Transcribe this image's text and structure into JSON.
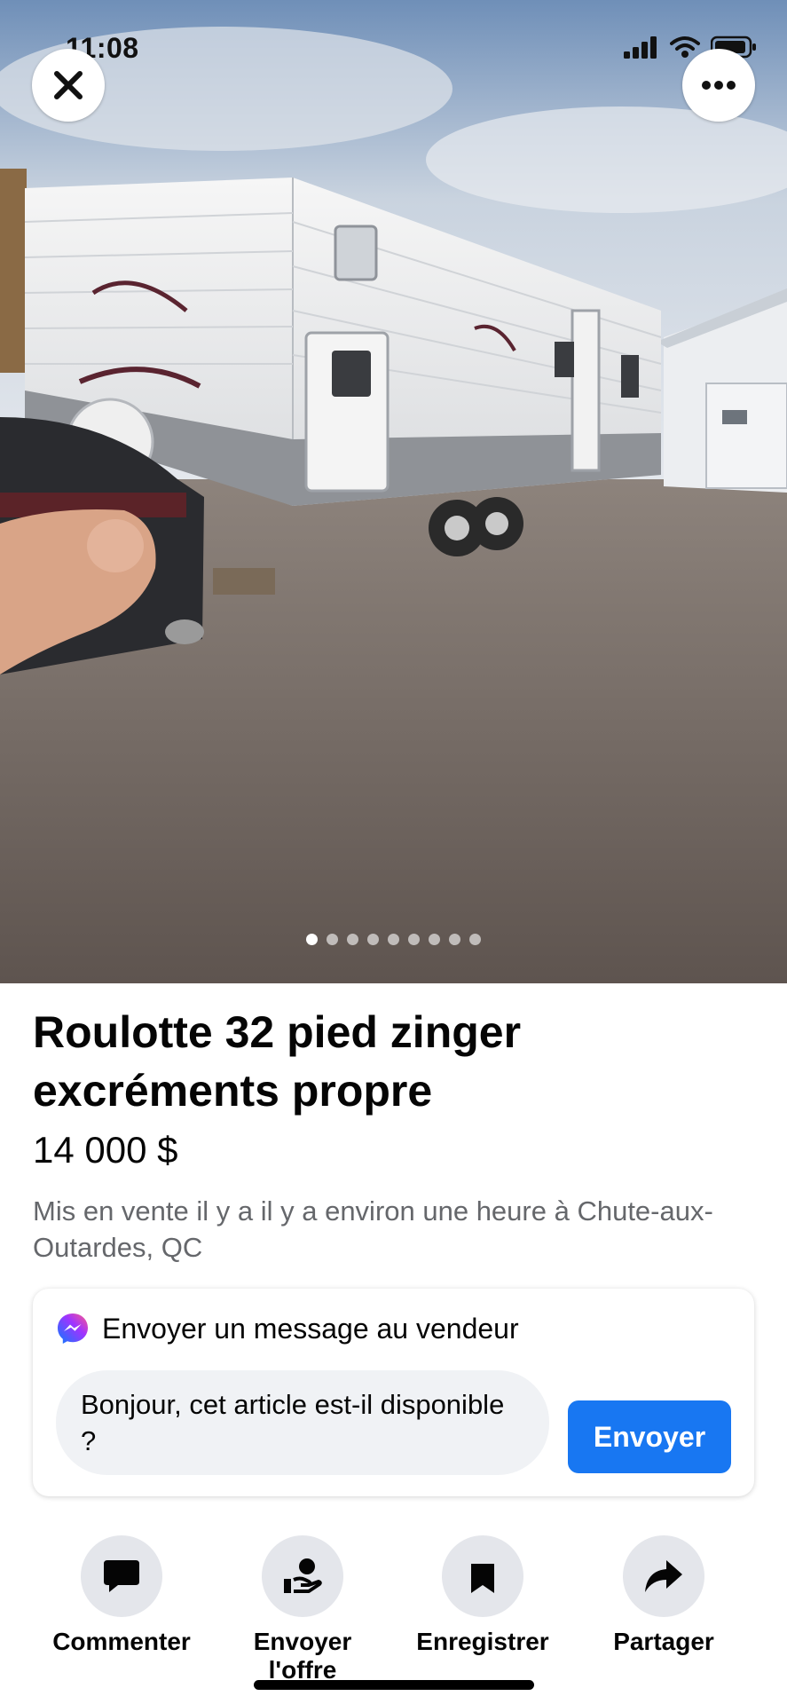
{
  "status_bar": {
    "time": "11:08"
  },
  "photo": {
    "description_icon_close": "close-icon",
    "description_icon_more": "more-icon",
    "carousel_total": 9,
    "carousel_active": 1
  },
  "listing": {
    "title": "Roulotte 32 pied zinger excréments propre",
    "price": "14 000 $",
    "meta": "Mis en vente il y a il y a environ une heure à Chute-aux-Outardes, QC"
  },
  "message": {
    "header": "Envoyer un message au vendeur",
    "input_value": "Bonjour, cet article est-il disponible ?",
    "send_label": "Envoyer"
  },
  "actions": [
    {
      "label": "Commenter",
      "icon": "comment-icon"
    },
    {
      "label": "Envoyer l'offre",
      "icon": "send-offer-icon"
    },
    {
      "label": "Enregistrer",
      "icon": "bookmark-icon"
    },
    {
      "label": "Partager",
      "icon": "share-icon"
    }
  ],
  "colors": {
    "accent": "#1877f2",
    "secondary_text": "#65676b",
    "action_bg": "#e4e6eb"
  }
}
